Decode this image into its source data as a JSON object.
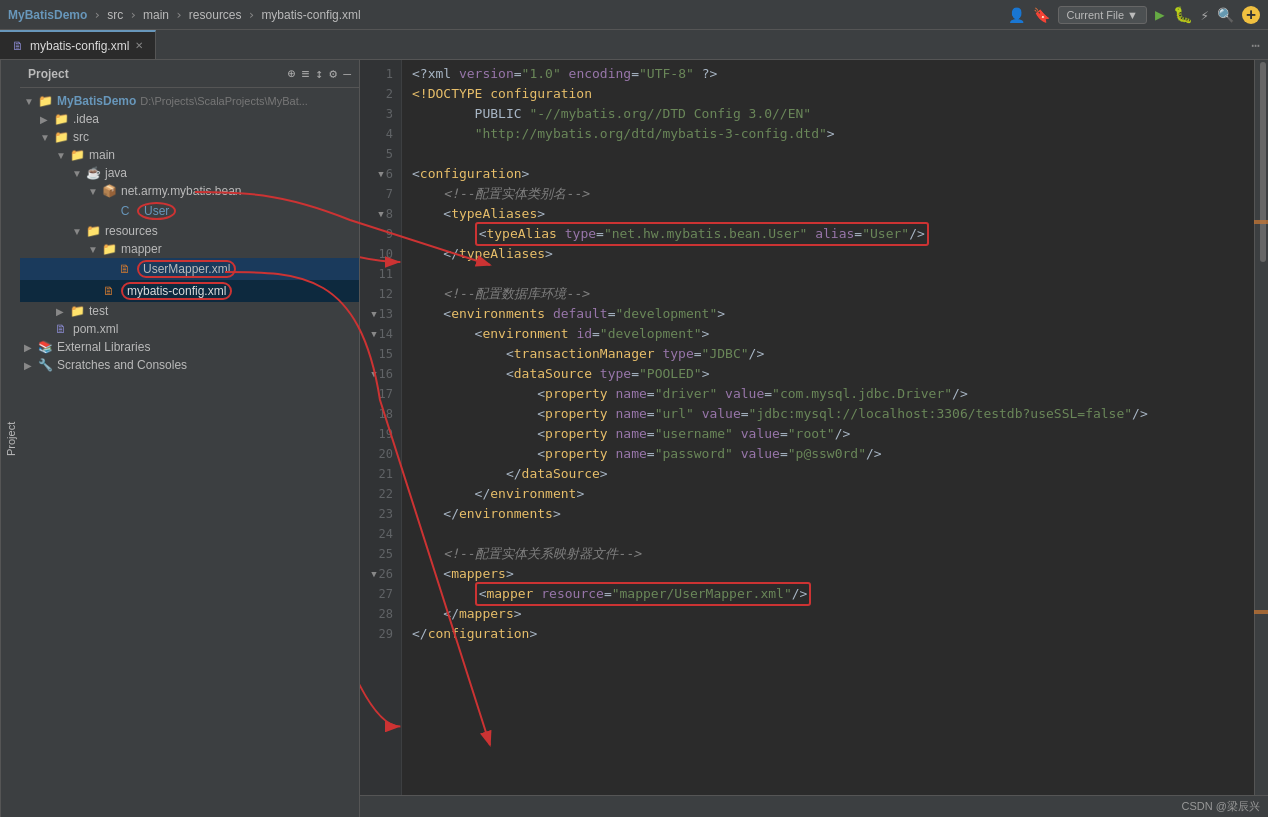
{
  "titlebar": {
    "project": "MyBatisDemo",
    "path1": "src",
    "path2": "main",
    "path3": "resources",
    "file": "mybatis-config.xml",
    "run_config": "Current File",
    "project_tab": "Project"
  },
  "tabs": [
    {
      "label": "mybatis-config.xml",
      "active": true,
      "icon": "xml"
    }
  ],
  "sidebar": {
    "header": "Project",
    "tree": [
      {
        "id": 1,
        "depth": 0,
        "arrow": "▼",
        "icon": "📁",
        "icon_color": "yellow",
        "label": "MyBatisDemo",
        "suffix": " D:\\Projects\\ScalaProjects\\MyBat...",
        "bold": true
      },
      {
        "id": 2,
        "depth": 1,
        "arrow": "▶",
        "icon": "📁",
        "icon_color": "yellow",
        "label": ".idea"
      },
      {
        "id": 3,
        "depth": 1,
        "arrow": "▼",
        "icon": "📁",
        "icon_color": "yellow",
        "label": "src"
      },
      {
        "id": 4,
        "depth": 2,
        "arrow": "▼",
        "icon": "📁",
        "icon_color": "yellow",
        "label": "main"
      },
      {
        "id": 5,
        "depth": 3,
        "arrow": "▼",
        "icon": "☕",
        "icon_color": "orange",
        "label": "java"
      },
      {
        "id": 6,
        "depth": 4,
        "arrow": "▼",
        "icon": "📦",
        "icon_color": "orange",
        "label": "net.army.mybatis.bean"
      },
      {
        "id": 7,
        "depth": 5,
        "arrow": "",
        "icon": "C",
        "icon_color": "blue",
        "label": "User",
        "circled": true
      },
      {
        "id": 8,
        "depth": 3,
        "arrow": "▼",
        "icon": "📁",
        "icon_color": "yellow",
        "label": "resources"
      },
      {
        "id": 9,
        "depth": 4,
        "arrow": "▼",
        "icon": "📁",
        "icon_color": "yellow",
        "label": "mapper"
      },
      {
        "id": 10,
        "depth": 5,
        "arrow": "",
        "icon": "🗎",
        "icon_color": "xml",
        "label": "UserMapper.xml",
        "circled": true,
        "selected": true
      },
      {
        "id": 11,
        "depth": 4,
        "arrow": "",
        "icon": "🗎",
        "icon_color": "xml",
        "label": "mybatis-config.xml",
        "active": true,
        "circled": true
      },
      {
        "id": 12,
        "depth": 2,
        "arrow": "▶",
        "icon": "📁",
        "icon_color": "yellow",
        "label": "test"
      },
      {
        "id": 13,
        "depth": 1,
        "arrow": "",
        "icon": "🗎",
        "icon_color": "xml",
        "label": "pom.xml"
      },
      {
        "id": 14,
        "depth": 0,
        "arrow": "▶",
        "icon": "📚",
        "icon_color": "blue",
        "label": "External Libraries"
      },
      {
        "id": 15,
        "depth": 0,
        "arrow": "▶",
        "icon": "🔧",
        "icon_color": "blue",
        "label": "Scratches and Consoles"
      }
    ]
  },
  "editor": {
    "filename": "mybatis-config.xml",
    "lines": [
      {
        "num": 1,
        "content": "<?xml version=\"1.0\" encoding=\"UTF-8\" ?>",
        "type": "pi"
      },
      {
        "num": 2,
        "content": "<!DOCTYPE configuration",
        "type": "doctype"
      },
      {
        "num": 3,
        "content": "        PUBLIC \"-//mybatis.org//DTD Config 3.0//EN\"",
        "type": "doctype"
      },
      {
        "num": 4,
        "content": "        \"http://mybatis.org/dtd/mybatis-3-config.dtd\">",
        "type": "doctype"
      },
      {
        "num": 5,
        "content": "",
        "type": "empty"
      },
      {
        "num": 6,
        "content": "<configuration>",
        "type": "tag",
        "fold": true
      },
      {
        "num": 7,
        "content": "    <!--配置实体类别名-->",
        "type": "comment"
      },
      {
        "num": 8,
        "content": "    <typeAliases>",
        "type": "tag",
        "fold": true
      },
      {
        "num": 9,
        "content": "        <typeAlias type=\"net.hw.mybatis.bean.User\" alias=\"User\"/>",
        "type": "tag",
        "highlight": true
      },
      {
        "num": 10,
        "content": "    </typeAliases>",
        "type": "tag"
      },
      {
        "num": 11,
        "content": "",
        "type": "empty"
      },
      {
        "num": 12,
        "content": "    <!--配置数据库环境-->",
        "type": "comment"
      },
      {
        "num": 13,
        "content": "    <environments default=\"development\">",
        "type": "tag",
        "fold": true
      },
      {
        "num": 14,
        "content": "        <environment id=\"development\">",
        "type": "tag",
        "fold": true
      },
      {
        "num": 15,
        "content": "            <transactionManager type=\"JDBC\"/>",
        "type": "tag"
      },
      {
        "num": 16,
        "content": "            <dataSource type=\"POOLED\">",
        "type": "tag",
        "fold": true
      },
      {
        "num": 17,
        "content": "                <property name=\"driver\" value=\"com.mysql.jdbc.Driver\"/>",
        "type": "tag"
      },
      {
        "num": 18,
        "content": "                <property name=\"url\" value=\"jdbc:mysql://localhost:3306/testdb?useSSL=false\"/>",
        "type": "tag"
      },
      {
        "num": 19,
        "content": "                <property name=\"username\" value=\"root\"/>",
        "type": "tag"
      },
      {
        "num": 20,
        "content": "                <property name=\"password\" value=\"p@ssw0rd\"/>",
        "type": "tag"
      },
      {
        "num": 21,
        "content": "            </dataSource>",
        "type": "tag"
      },
      {
        "num": 22,
        "content": "        </environment>",
        "type": "tag"
      },
      {
        "num": 23,
        "content": "    </environments>",
        "type": "tag"
      },
      {
        "num": 24,
        "content": "",
        "type": "empty"
      },
      {
        "num": 25,
        "content": "    <!--配置实体关系映射器文件-->",
        "type": "comment"
      },
      {
        "num": 26,
        "content": "    <mappers>",
        "type": "tag",
        "fold": true
      },
      {
        "num": 27,
        "content": "        <mapper resource=\"mapper/UserMapper.xml\"/>",
        "type": "tag",
        "highlight": true
      },
      {
        "num": 28,
        "content": "    </mappers>",
        "type": "tag"
      },
      {
        "num": 29,
        "content": "</configuration>",
        "type": "tag"
      }
    ]
  },
  "status": {
    "right": "CSDN @梁辰兴"
  }
}
